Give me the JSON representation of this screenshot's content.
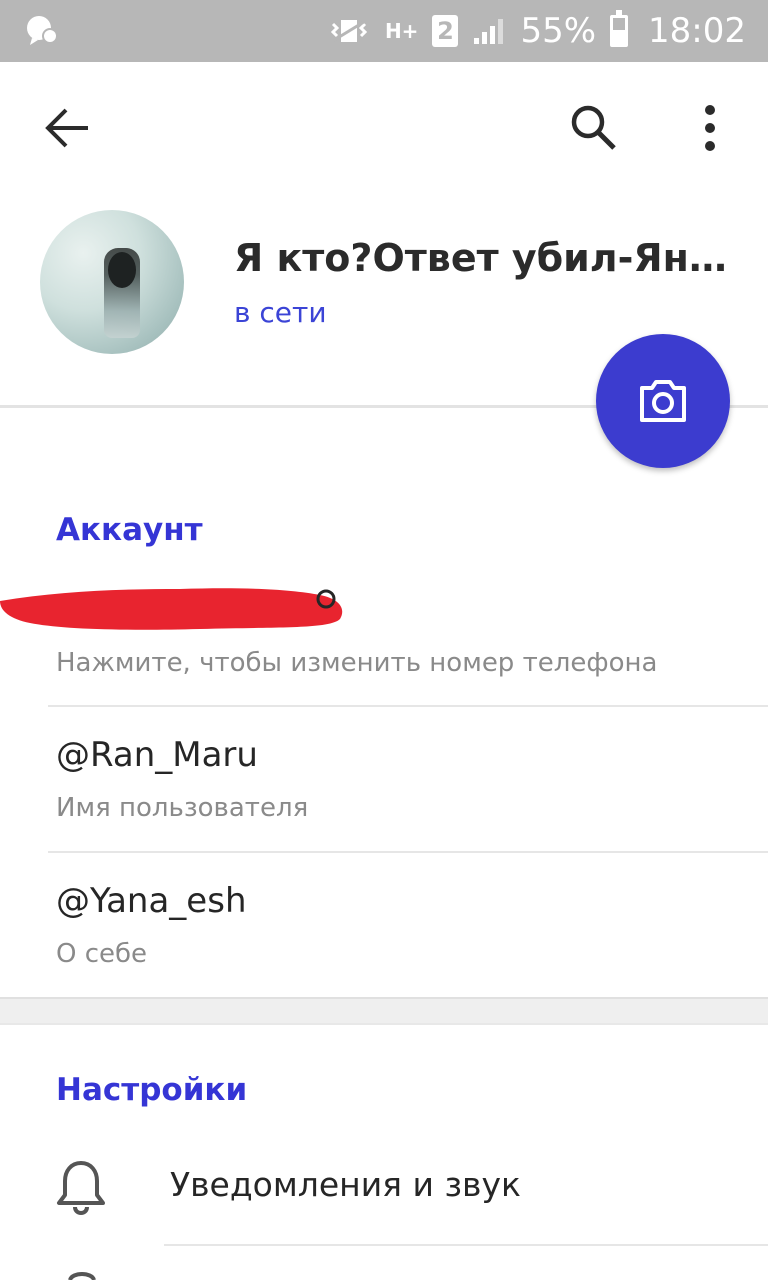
{
  "status_bar": {
    "network_type": "H+",
    "sim_slot": "2",
    "battery_percent": "55%",
    "battery_level": 0.55,
    "time": "18:02",
    "icons": [
      "chat-notification-icon",
      "vibrate-icon",
      "signal-icon",
      "battery-icon"
    ]
  },
  "top_bar": {
    "icons": [
      "back-arrow-icon",
      "search-icon",
      "more-vert-icon"
    ]
  },
  "profile": {
    "name": "Я кто?Ответ убил-Ян…",
    "status": "в сети",
    "fab_icon": "camera-icon"
  },
  "account": {
    "section_title": "Аккаунт",
    "phone_hint": "Нажмите, чтобы изменить номер телефона",
    "username_value": "@Ran_Maru",
    "username_hint": "Имя пользователя",
    "bio_value": "@Yana_esh",
    "bio_hint": "О себе"
  },
  "settings": {
    "section_title": "Настройки",
    "items": [
      {
        "label": "Уведомления и звук",
        "icon": "bell-icon"
      }
    ]
  },
  "colors": {
    "accent": "#3535d5",
    "fab": "#3c3ccf",
    "status_bar": "#b7b7b7",
    "redaction": "#e8242f"
  }
}
